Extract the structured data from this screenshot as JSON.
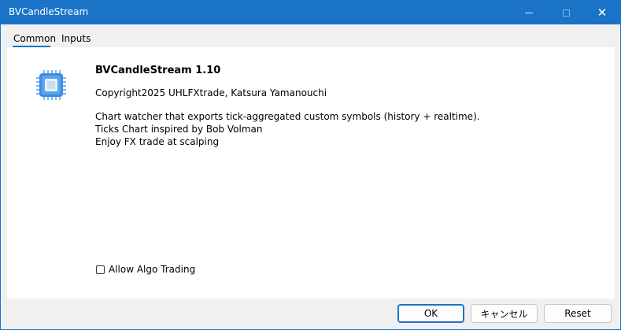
{
  "window": {
    "title": "BVCandleStream",
    "controls": {
      "minimize_icon": "minimize-icon",
      "maximize_icon": "maximize-icon",
      "close_icon": "close-icon"
    }
  },
  "tabs": [
    {
      "label": "Common",
      "active": true
    },
    {
      "label": "Inputs",
      "active": false
    }
  ],
  "common": {
    "icon": "expert-advisor-chip-icon",
    "ea_title": "BVCandleStream 1.10",
    "copyright": "Copyright2025 UHLFXtrade, Katsura Yamanouchi",
    "description": [
      "Chart watcher that exports tick-aggregated custom symbols (history + realtime).",
      "Ticks Chart inspired by Bob Volman",
      "Enjoy FX trade at scalping"
    ],
    "allow_algo_trading": {
      "label": "Allow Algo Trading",
      "checked": false
    }
  },
  "buttons": {
    "ok": "OK",
    "cancel": "キャンセル",
    "reset": "Reset"
  },
  "colors": {
    "accent": "#1a73c7",
    "chip": "#3b8de0"
  }
}
